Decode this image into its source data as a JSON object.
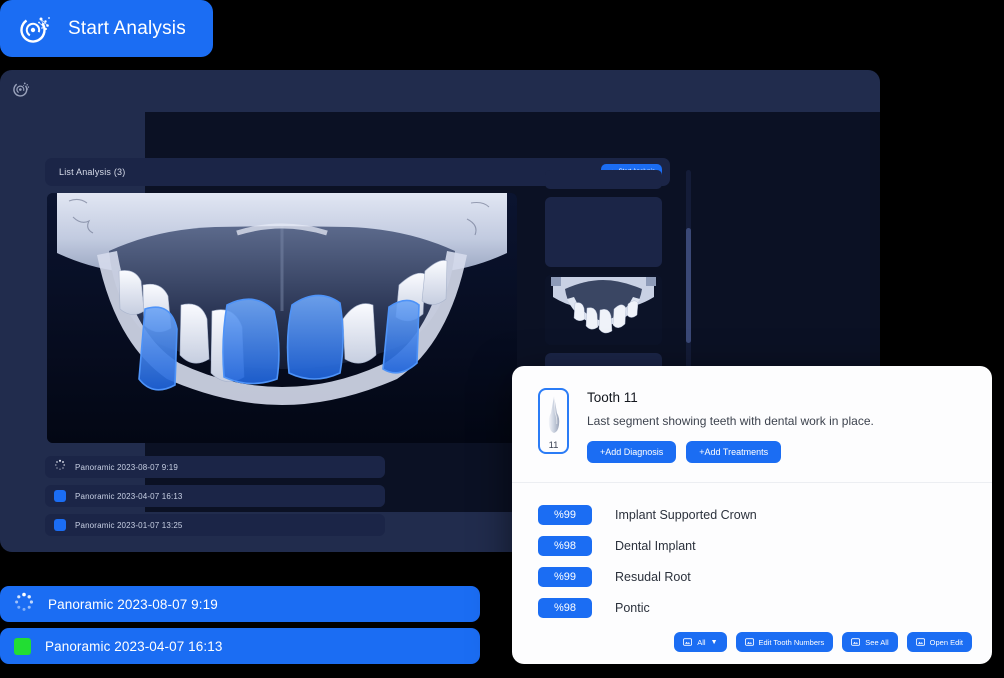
{
  "cta": {
    "label": "Start Analysis",
    "icon": "analysis-swirl-icon",
    "bg": "#1B6DF3"
  },
  "app_window": {
    "logo_icon": "analysis-swirl-icon",
    "topbar_bg": "#212C4D",
    "body_bg": "#0B1124",
    "list_header": {
      "title": "List Analysis (3)",
      "button_label": "Start Analysis",
      "button_icon": "analysis-swirl-icon"
    },
    "viewer": {
      "name": "dental-cast-photo",
      "highlighted_teeth": 4,
      "highlight_color": "#2E76E8"
    },
    "analysis_items": [
      {
        "icon": "spinner-icon",
        "label": "Panoramic 2023-08-07 9:19"
      },
      {
        "icon": "blue-square-icon",
        "label": "Panoramic 2023-04-07 16:13"
      },
      {
        "icon": "blue-square-icon",
        "label": "Panoramic 2023-01-07 13:25"
      }
    ],
    "thumbnails": [
      {
        "type": "bar",
        "has_image": false
      },
      {
        "type": "card",
        "has_image": false
      },
      {
        "type": "card",
        "has_image": true
      },
      {
        "type": "card",
        "has_image": false
      }
    ],
    "scrollbar": {
      "name": "vertical-scrollbar"
    }
  },
  "blue_cards": [
    {
      "icon": "spinner-icon",
      "label": "Panoramic 2023-08-07 9:19"
    },
    {
      "icon": "green-square-icon",
      "label": "Panoramic 2023-04-07 16:13",
      "icon_color": "#22DD33"
    }
  ],
  "detail_panel": {
    "tooth_number": "11",
    "tooth_icon": "tooth-icon",
    "title": "Tooth 11",
    "description": "Last segment showing teeth with dental work in place.",
    "actions": [
      {
        "label": "+Add Diagnosis",
        "name": "add-diagnosis-button"
      },
      {
        "label": "+Add Treatments",
        "name": "add-treatments-button"
      }
    ],
    "findings": [
      {
        "confidence": "%99",
        "name": "Implant Supported Crown"
      },
      {
        "confidence": "%98",
        "name": "Dental Implant"
      },
      {
        "confidence": "%99",
        "name": "Resudal Root"
      },
      {
        "confidence": "%98",
        "name": "Pontic"
      }
    ],
    "footer_buttons": [
      {
        "label": "All",
        "icon": "image-card-icon",
        "has_chevron": true,
        "name": "filter-all-dropdown"
      },
      {
        "label": "Edit Tooth Numbers",
        "icon": "image-card-icon",
        "has_chevron": false,
        "name": "edit-tooth-numbers-button"
      },
      {
        "label": "See All",
        "icon": "image-card-icon",
        "has_chevron": false,
        "name": "see-all-button"
      },
      {
        "label": "Open Edit",
        "icon": "image-card-icon",
        "has_chevron": false,
        "name": "open-edit-button"
      }
    ]
  },
  "colors": {
    "accent": "#1B6DF3",
    "panel_dark": "#212C4D",
    "surface_dark": "#0B1124",
    "white_panel": "#FDFDFE",
    "green": "#22DD33"
  }
}
